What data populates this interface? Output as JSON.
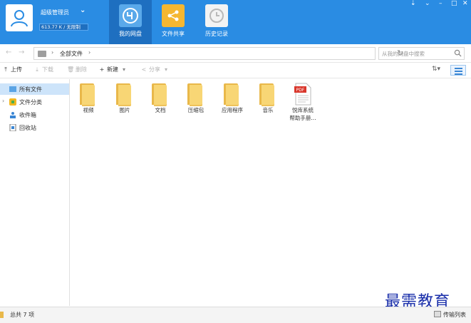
{
  "header": {
    "username": "超级管理员",
    "quota": "613.77 K / 无限制",
    "tabs": [
      {
        "label": "我的网盘",
        "icon": "my-disk-icon",
        "active": true
      },
      {
        "label": "文件共享",
        "icon": "share-icon",
        "active": false
      },
      {
        "label": "历史记录",
        "icon": "history-icon",
        "active": false
      }
    ],
    "colors": {
      "brand": "#2a8ce3",
      "active_tab": "#1e6fc0"
    }
  },
  "address_bar": {
    "path": "全部文件",
    "search_placeholder": "从我的网盘中搜索"
  },
  "toolbar": {
    "upload": "上传",
    "download": "下载",
    "delete": "删除",
    "new": "新建",
    "share": "分享"
  },
  "sidebar": {
    "items": [
      {
        "label": "所有文件",
        "icon": "folder-icon",
        "active": true
      },
      {
        "label": "文件分类",
        "icon": "category-icon",
        "active": false
      },
      {
        "label": "收件箱",
        "icon": "inbox-icon",
        "active": false
      },
      {
        "label": "回收站",
        "icon": "recycle-bin-icon",
        "active": false
      }
    ]
  },
  "files": [
    {
      "name": "视频",
      "type": "folder"
    },
    {
      "name": "图片",
      "type": "folder"
    },
    {
      "name": "文档",
      "type": "folder"
    },
    {
      "name": "压缩包",
      "type": "folder"
    },
    {
      "name": "应用程序",
      "type": "folder"
    },
    {
      "name": "音乐",
      "type": "folder"
    },
    {
      "name_line1": "悦库系统",
      "name_line2": "帮助手册...",
      "type": "pdf",
      "badge": "PDF"
    }
  ],
  "status": {
    "count_text": "总共 7 项",
    "transfer_list": "传输列表"
  },
  "watermark": "最需教育"
}
